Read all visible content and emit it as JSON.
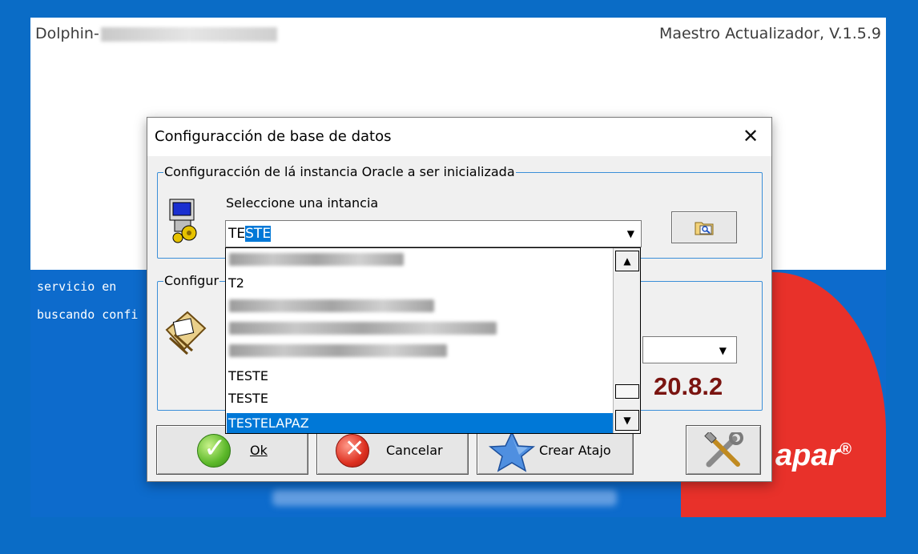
{
  "app": {
    "title_left": "Dolphin-",
    "title_right": "Maestro Actualizador, V.1.5.9",
    "status_line1": "servicio en",
    "status_line2": "buscando confi",
    "brand": "apar",
    "brand_mark": "®"
  },
  "dialog": {
    "title": "Configuracción de base de datos",
    "close_glyph": "✕",
    "group1_title": "Configuracción de lá instancia Oracle a ser inicializada",
    "select_label": "Seleccione una intancia",
    "combo_value_prefix": "TE",
    "combo_value_selected": "STE",
    "group2_title": "Configur",
    "version": "20.8.2",
    "buttons": {
      "ok": "Ok",
      "cancel": "Cancelar",
      "shortcut": "Crear Atajo"
    }
  },
  "dropdown": {
    "items": [
      "T2",
      "TESTE",
      "TESTE"
    ],
    "selected": "TESTELAPAZ"
  },
  "colors": {
    "desktop": "#0a6cc6",
    "selection": "#0078d7",
    "version": "#7a1410",
    "brand": "#e8312a"
  }
}
